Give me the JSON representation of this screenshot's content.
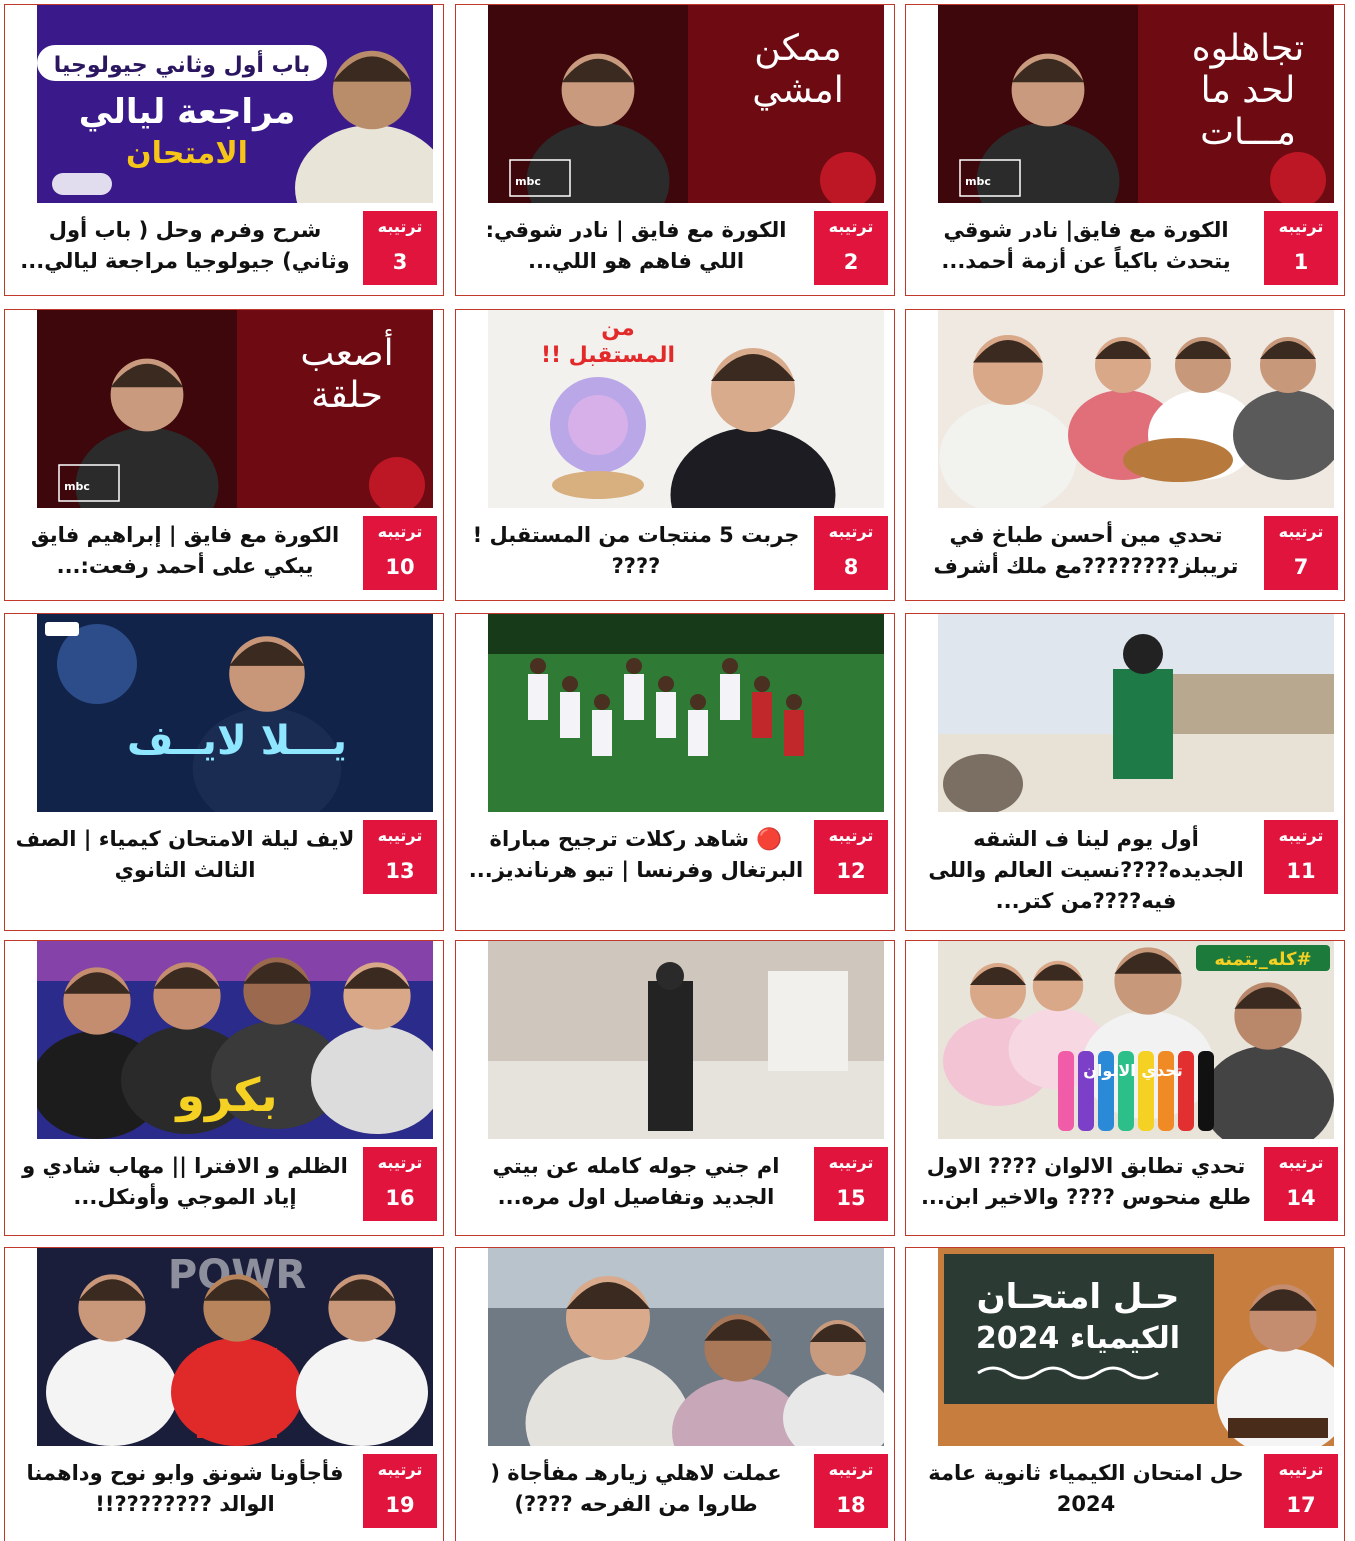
{
  "rank_label": "ترتيبه",
  "cards": [
    {
      "rank": "1",
      "title": "الكورة مع فايق| نادر شوقي يتحدث باكياً عن أزمة أحمد...",
      "thumb_lines": [
        "تجاهلوه",
        "لحد ما",
        "مـــات"
      ],
      "thumb_style": "mbc"
    },
    {
      "rank": "2",
      "title": "الكورة مع فايق | نادر شوقي: اللي فاهم هو اللي...",
      "thumb_lines": [
        "ممكن",
        "امشي"
      ],
      "thumb_style": "mbc"
    },
    {
      "rank": "3",
      "title": "شرح وفرم وحل ( باب أول وثاني) جيولوجيا مراجعة ليالي...",
      "thumb_lines": [
        "باب أول وثاني جيولوجيا",
        "مراجعة ليالي",
        "الامتحان"
      ],
      "thumb_style": "purple"
    },
    {
      "rank": "7",
      "title": "تحدي مين أحسن طباخ في تريبلز????????مع ملك أشرف",
      "thumb_lines": [],
      "thumb_style": "kitchen"
    },
    {
      "rank": "8",
      "title": "جربت 5 منتجات من المستقبل ! ????",
      "thumb_lines": [
        "من",
        "المستقبل !!"
      ],
      "thumb_style": "future"
    },
    {
      "rank": "10",
      "title": "الكورة مع فايق | إبراهيم فايق يبكي على أحمد رفعت:...",
      "thumb_lines": [
        "أصعب",
        "حلقة"
      ],
      "thumb_style": "mbc"
    },
    {
      "rank": "11",
      "title": "أول يوم لينا ف الشقه الجديده????نسيت العالم واللى فيه????من كتر...",
      "thumb_lines": [],
      "thumb_style": "balcony"
    },
    {
      "rank": "12",
      "title": "🔴 شاهد ركلات ترجيح مباراة البرتغال وفرنسا | تيو هرنانديز...",
      "thumb_lines": [],
      "thumb_style": "football"
    },
    {
      "rank": "13",
      "title": "لايف ليلة الامتحان كيمياء | الصف الثالث الثانوي",
      "thumb_lines": [
        "يـــلا لايــف"
      ],
      "thumb_style": "live"
    },
    {
      "rank": "14",
      "title": "تحدي تطابق الالوان ???? الاول طلع منحوس ???? والاخير ابن...",
      "thumb_lines": [
        "#كله_بتمنه",
        "تحدي الالوان"
      ],
      "thumb_style": "bottles"
    },
    {
      "rank": "15",
      "title": "ام جني جوله كامله عن بيتي الجديد وتفاصيل اول مره...",
      "thumb_lines": [],
      "thumb_style": "house"
    },
    {
      "rank": "16",
      "title": "الظلم و الافترا || مهاب شادي و إياد الموجي وأونكل...",
      "thumb_lines": [
        "بكرو"
      ],
      "thumb_style": "guys"
    },
    {
      "rank": "17",
      "title": "حل امتحان الكيمياء ثانوية عامة 2024",
      "thumb_lines": [
        "حـل امتحـان",
        "الكيمياء 2024"
      ],
      "thumb_style": "chalk"
    },
    {
      "rank": "18",
      "title": "عملت لاهلي زيارهـ مفأجاة ( طاروا من الفرحه ????)",
      "thumb_lines": [],
      "thumb_style": "car"
    },
    {
      "rank": "19",
      "title": "فأجأونا شونق وابو نوح وداهمنا الوالد ????????!!",
      "thumb_lines": [
        "POWR"
      ],
      "thumb_style": "powr"
    }
  ],
  "colors": {
    "rank_bg": "#e0143c",
    "card_border": "#c0392b",
    "title_text": "#111111",
    "accent_link": "#1a3ccc"
  }
}
